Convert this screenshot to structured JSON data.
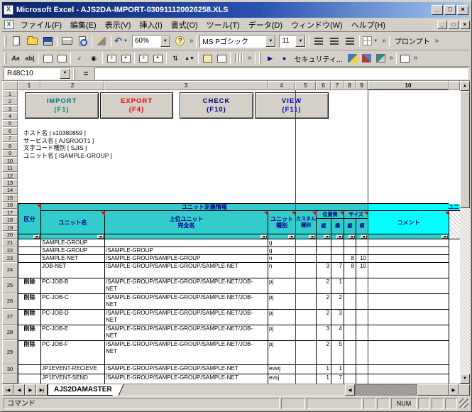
{
  "window_title": "Microsoft Excel - AJS2DA-IMPORT-030911120026258.XLS",
  "menu_items": [
    "ファイル(F)",
    "編集(E)",
    "表示(V)",
    "挿入(I)",
    "書式(O)",
    "ツール(T)",
    "データ(D)",
    "ウィンドウ(W)",
    "ヘルプ(H)"
  ],
  "toolbar1": {
    "zoom_value": "60%",
    "font_name": "MS Pゴシック",
    "font_size": "11",
    "prompt_label": "プロンプト"
  },
  "toolbar2": {
    "label_aa": "Aa",
    "label_ab": "ab|",
    "security_label": "セキュリティ..."
  },
  "formula": {
    "name_box": "R48C10",
    "equals": "="
  },
  "grid": {
    "col_headers": [
      "1",
      "2",
      "3",
      "4",
      "5",
      "6",
      "7",
      "8",
      "9",
      "10"
    ],
    "selected_col": "10",
    "row_headers": [
      "1",
      "2",
      "3",
      "4",
      "5",
      "6",
      "7",
      "8",
      "9",
      "10",
      "11",
      "12",
      "13",
      "14",
      "15",
      "16",
      "17",
      "18",
      "19",
      "20",
      "21",
      "22",
      "23",
      "24",
      "25",
      "26",
      "27",
      "28",
      "29",
      "30",
      ""
    ]
  },
  "action_buttons": [
    {
      "label": "IMPORT",
      "key": "(F1)",
      "color": "#008080"
    },
    {
      "label": "EXPORT",
      "key": "(F4)",
      "color": "#ff0000"
    },
    {
      "label": "CHECK",
      "key": "(F10)",
      "color": "#000080"
    },
    {
      "label": "VIEW",
      "key": "(F11)",
      "color": "#0000cc"
    }
  ],
  "info_lines": [
    "ホスト名 [ s10380859 ]",
    "サービス名 [ AJSROOT1 ]",
    "文字コード種別 [ SJIS ]",
    "ユニット名 [ /SAMPLE-GROUP ]"
  ],
  "unit_table": {
    "band_title": "ユニット定義情報",
    "band_right": "ユニ",
    "headers": {
      "kubun": "区分",
      "unit_name": "ユニット名",
      "parent": "上位ユニット\n完全名",
      "unit_type": "ユニット\n種別",
      "custom": "カスタム\n種別",
      "position": "位置情",
      "size": "サイズ",
      "v": "縦",
      "h": "横",
      "comment": "コメント"
    },
    "rows": [
      {
        "cells": [
          "",
          "SAMPLE-GROUP",
          "",
          "g",
          "",
          "",
          "",
          "",
          "",
          ""
        ]
      },
      {
        "cells": [
          "",
          "SAMPLE-GROUP",
          "/SAMPLE-GROUP",
          "g",
          "",
          "",
          "",
          "",
          "",
          ""
        ]
      },
      {
        "cells": [
          "",
          "SAMPLE-NET",
          "/SAMPLE-GROUP/SAMPLE-GROUP",
          "n",
          "",
          "",
          "",
          "8",
          "10",
          ""
        ]
      },
      {
        "cells": [
          "",
          "JOB-NET",
          "/SAMPLE-GROUP/SAMPLE-GROUP/SAMPLE-NET",
          "n",
          "",
          "3",
          "7",
          "8",
          "10",
          ""
        ]
      },
      {
        "cells": [
          "削除",
          "PC-JOB-B",
          "/SAMPLE-GROUP/SAMPLE-GROUP/SAMPLE-NET/JOB-\nNET",
          "pj",
          "",
          "2",
          "1",
          "",
          "",
          ""
        ]
      },
      {
        "cells": [
          "削除",
          "PC-JOB-C",
          "/SAMPLE-GROUP/SAMPLE-GROUP/SAMPLE-NET/JOB-\nNET",
          "pj",
          "",
          "2",
          "2",
          "",
          "",
          ""
        ]
      },
      {
        "cells": [
          "削除",
          "PC-JOB-D",
          "/SAMPLE-GROUP/SAMPLE-GROUP/SAMPLE-NET/JOB-\nNET",
          "pj",
          "",
          "2",
          "3",
          "",
          "",
          ""
        ]
      },
      {
        "cells": [
          "削除",
          "PC-JOB-E",
          "/SAMPLE-GROUP/SAMPLE-GROUP/SAMPLE-NET/JOB-\nNET",
          "pj",
          "",
          "3",
          "4",
          "",
          "",
          ""
        ]
      },
      {
        "cells": [
          "削除",
          "PC-JOB-F",
          "/SAMPLE-GROUP/SAMPLE-GROUP/SAMPLE-NET/JOB-\nNET",
          "pj",
          "",
          "2",
          "5",
          "",
          "",
          ""
        ]
      },
      {
        "cells": [
          "",
          "JP1EVENT-RECIEVE",
          "/SAMPLE-GROUP/SAMPLE-GROUP/SAMPLE-NET",
          "evwj",
          "",
          "1",
          "1",
          "",
          "",
          ""
        ]
      },
      {
        "cells": [
          "",
          "JP1EVENT-SEND",
          "/SAMPLE-GROUP/SAMPLE-GROUP/SAMPLE-NET",
          "evsj",
          "",
          "1",
          "7",
          "",
          "",
          ""
        ]
      }
    ]
  },
  "sheet_tab": "AJS2DAMASTER",
  "status": {
    "message": "コマンド",
    "num": "NUM"
  },
  "glyphs": {
    "chevron": "»",
    "dropdown": "▼",
    "up_arrow": "▲",
    "down_arrow": "▼",
    "left_arrow": "◀",
    "right_arrow": "▶",
    "undo": "↶",
    "run": "▶",
    "record": "●",
    "help": "?",
    "radio": "◉",
    "check": "✓",
    "spin": "⇅",
    "minimize": "_",
    "maximize": "□",
    "close": "×",
    "tab_first": "|◀",
    "tab_prev": "◀",
    "tab_next": "▶",
    "tab_last": "▶|",
    "excel_x": "X"
  },
  "colors": {
    "header_teal": "#33cccc",
    "header_cyan": "#00ffff",
    "header_text": "#000080",
    "import": "#008080",
    "export": "#ff0000",
    "check": "#000080",
    "view": "#0000cc",
    "comment_marker": "#e00000"
  }
}
